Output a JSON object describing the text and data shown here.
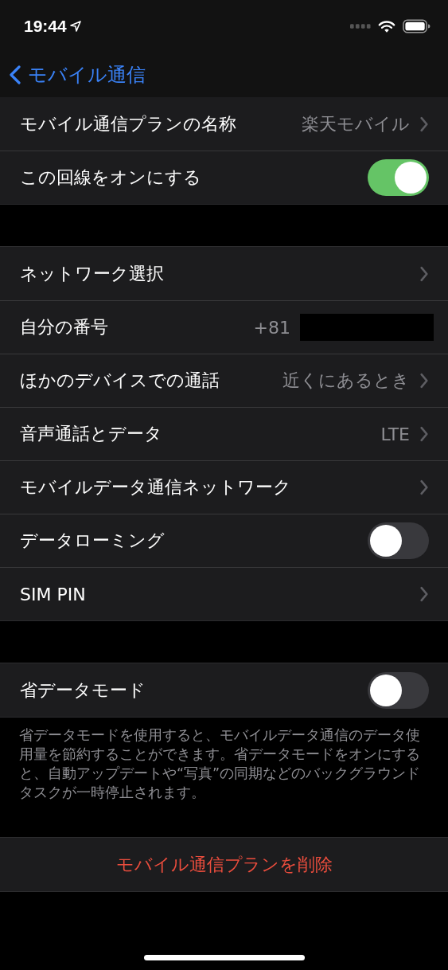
{
  "status_bar": {
    "time": "19:44"
  },
  "nav": {
    "back_label": "モバイル通信"
  },
  "groups": [
    {
      "rows": [
        {
          "kind": "link",
          "label": "モバイル通信プランの名称",
          "value": "楽天モバイル"
        },
        {
          "kind": "toggle",
          "label": "この回線をオンにする",
          "on": true
        }
      ]
    },
    {
      "rows": [
        {
          "kind": "link",
          "label": "ネットワーク選択"
        },
        {
          "kind": "number",
          "label": "自分の番号",
          "value": "+81"
        },
        {
          "kind": "link",
          "label": "ほかのデバイスでの通話",
          "value": "近くにあるとき"
        },
        {
          "kind": "link",
          "label": "音声通話とデータ",
          "value": "LTE"
        },
        {
          "kind": "link",
          "label": "モバイルデータ通信ネットワーク"
        },
        {
          "kind": "toggle",
          "label": "データローミング",
          "on": false
        },
        {
          "kind": "link",
          "label": "SIM PIN"
        }
      ]
    },
    {
      "rows": [
        {
          "kind": "toggle",
          "label": "省データモード",
          "on": false
        }
      ],
      "footer": "省データモードを使用すると、モバイルデータ通信のデータ使用量を節約することができます。省データモードをオンにすると、自動アップデートや“写真”の同期などのバックグラウンドタスクが一時停止されます。"
    },
    {
      "rows": [
        {
          "kind": "action",
          "label": "モバイル通信プランを削除"
        }
      ]
    }
  ]
}
